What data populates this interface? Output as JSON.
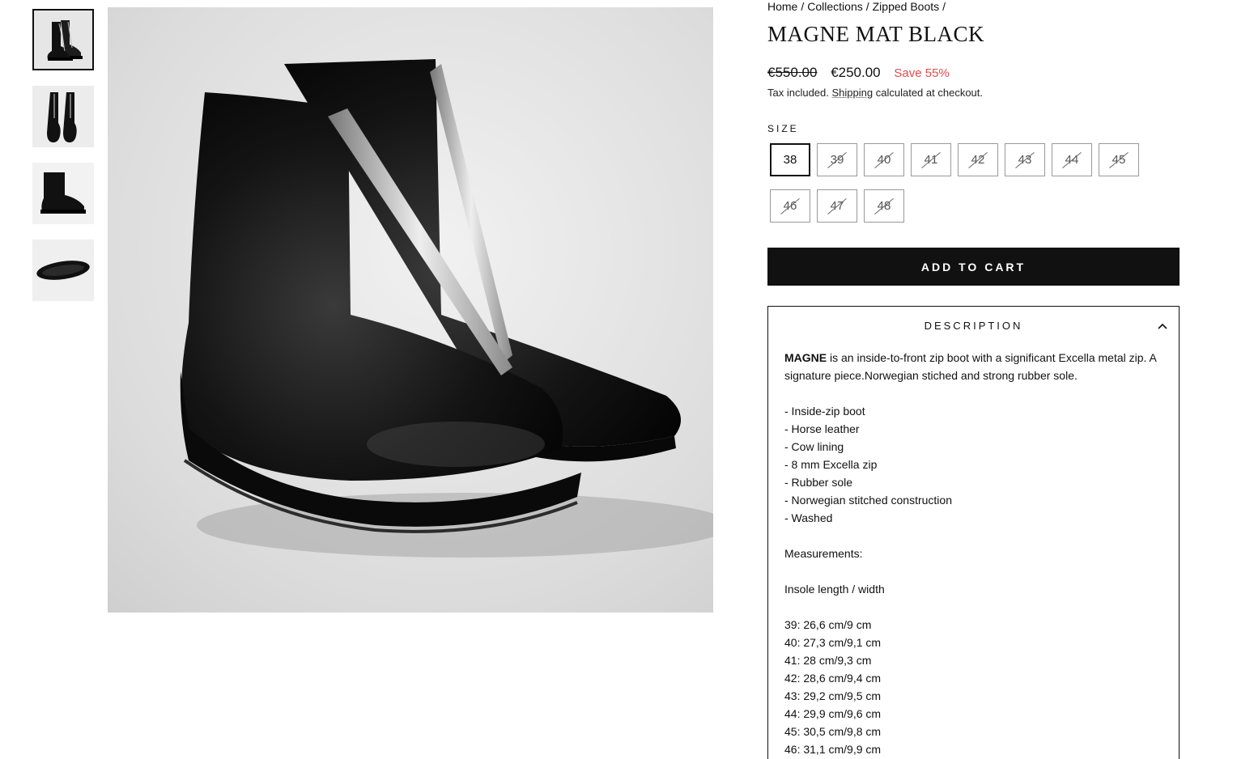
{
  "breadcrumb": [
    "Home",
    "Collections",
    "Zipped Boots"
  ],
  "breadcrumb_sep": "/",
  "product": {
    "title": "MAGNE MAT BLACK",
    "price_old": "€550.00",
    "price_new": "€250.00",
    "save": "Save 55%",
    "tax_prefix": "Tax included.",
    "tax_link": "Shipping",
    "tax_suffix": "calculated at checkout."
  },
  "size": {
    "label": "SIZE",
    "selected": "38",
    "options": [
      {
        "label": "38",
        "available": true
      },
      {
        "label": "39",
        "available": false
      },
      {
        "label": "40",
        "available": false
      },
      {
        "label": "41",
        "available": false
      },
      {
        "label": "42",
        "available": false
      },
      {
        "label": "43",
        "available": false
      },
      {
        "label": "44",
        "available": false
      },
      {
        "label": "45",
        "available": false
      },
      {
        "label": "46",
        "available": false
      },
      {
        "label": "47",
        "available": false
      },
      {
        "label": "48",
        "available": false
      }
    ]
  },
  "cart": {
    "label": "ADD TO CART"
  },
  "description": {
    "header": "DESCRIPTION",
    "intro_bold": "MAGNE",
    "intro_rest": " is an inside-to-front zip boot with a significant Excella metal zip. A signature piece.Norwegian stiched and strong rubber sole.",
    "features": [
      "- Inside-zip boot",
      "- Horse leather",
      "- Cow lining",
      "- 8 mm Excella zip",
      "- Rubber sole",
      "- Norwegian stitched construction",
      "- Washed"
    ],
    "measurements_label": "Measurements:",
    "insole_label": "Insole length / width",
    "measurements": [
      "39: 26,6 cm/9 cm",
      "40: 27,3 cm/9,1 cm",
      "41: 28 cm/9,3 cm",
      "42: 28,6 cm/9,4 cm",
      "43: 29,2 cm/9,5 cm",
      "44: 29,9 cm/9,6 cm",
      "45: 30,5 cm/9,8 cm",
      "46: 31,1 cm/9,9 cm"
    ]
  },
  "gallery": {
    "thumbnails": [
      "boots-side-pair",
      "boots-front-pair",
      "boot-side-single",
      "boot-sole"
    ],
    "active_index": 0
  }
}
